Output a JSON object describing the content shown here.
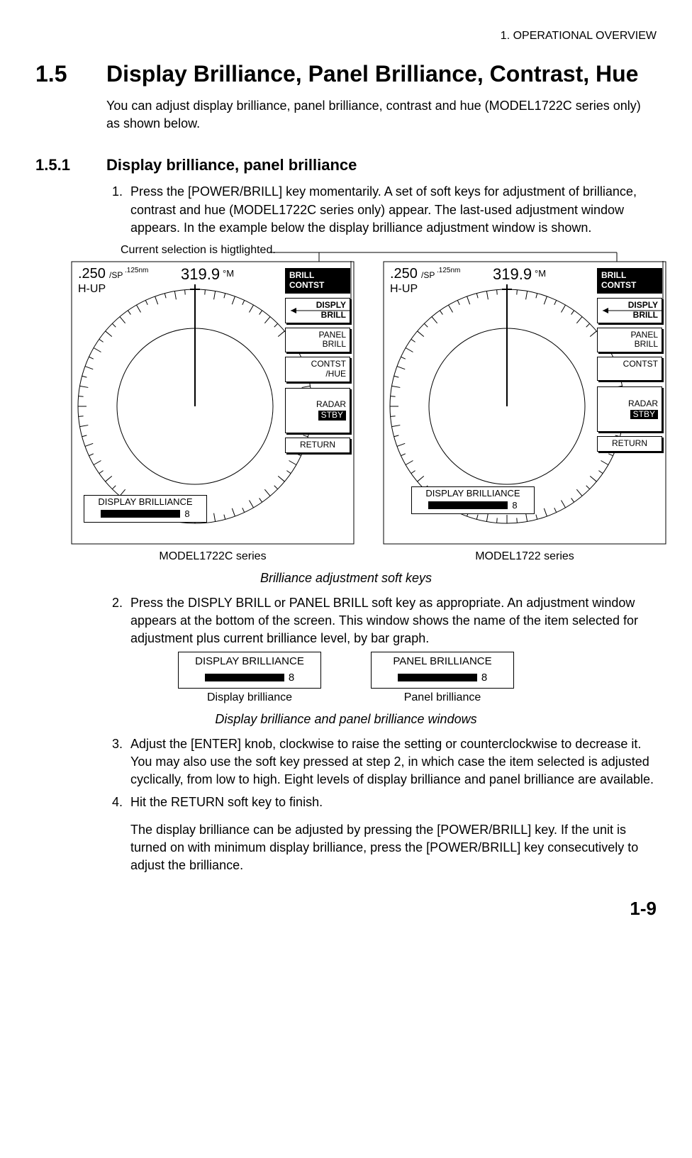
{
  "running_head": "1. OPERATIONAL OVERVIEW",
  "section": {
    "num": "1.5",
    "title": "Display Brilliance, Panel Brilliance, Contrast, Hue",
    "intro": "You can adjust display brilliance, panel brilliance, contrast and hue (MODEL1722C series only) as shown below."
  },
  "subsection": {
    "num": "1.5.1",
    "title": "Display brilliance, panel brilliance"
  },
  "steps": {
    "s1": "Press the [POWER/BRILL] key momentarily. A set of soft keys for adjustment of brilliance, contrast and hue (MODEL1722C series only) appear. The last-used adjustment window appears. In the example below the display brilliance adjustment window is shown.",
    "s2": "Press the DISPLY BRILL or PANEL BRILL soft key as appropriate. An adjustment window appears at the bottom of the screen. This window shows the name of the item selected for adjustment plus current brilliance level, by bar graph.",
    "s3": "Adjust the [ENTER] knob, clockwise to raise the setting or counterclockwise to decrease it. You may also use the soft key pressed at step 2, in which case the item selected is adjusted cyclically, from low to high. Eight levels of display brilliance and panel brilliance are available.",
    "s4": "Hit the RETURN soft key to finish.",
    "tail": "The display brilliance can be adjusted by pressing the [POWER/BRILL] key. If the unit is turned on with minimum display brilliance, press the [POWER/BRILL] key consecutively to adjust the brilliance."
  },
  "callout": "Current selection is higtlighted.",
  "radar": {
    "range": ".250",
    "sp": "/SP",
    "rr": ".125nm",
    "hup": "H-UP",
    "heading": "319.9",
    "deg": "°M"
  },
  "soft": {
    "heading": "BRILL\nCONTST",
    "disply_brill": "DISPLY\nBRILL",
    "panel_brill": "PANEL\nBRILL",
    "contst_hue": "CONTST\n/HUE",
    "contst": "CONTST",
    "radar": "RADAR",
    "stby": "STBY",
    "return": "RETURN"
  },
  "brilliance": {
    "display_title": "DISPLAY BRILLIANCE",
    "panel_title": "PANEL BRILLIANCE",
    "value": "8"
  },
  "models": {
    "left": "MODEL1722C series",
    "right": "MODEL1722 series"
  },
  "captions": {
    "fig1": "Brilliance adjustment soft keys",
    "disp": "Display brilliance",
    "panel": "Panel brilliance",
    "fig2": "Display brilliance and panel brilliance windows"
  },
  "page": "1-9"
}
